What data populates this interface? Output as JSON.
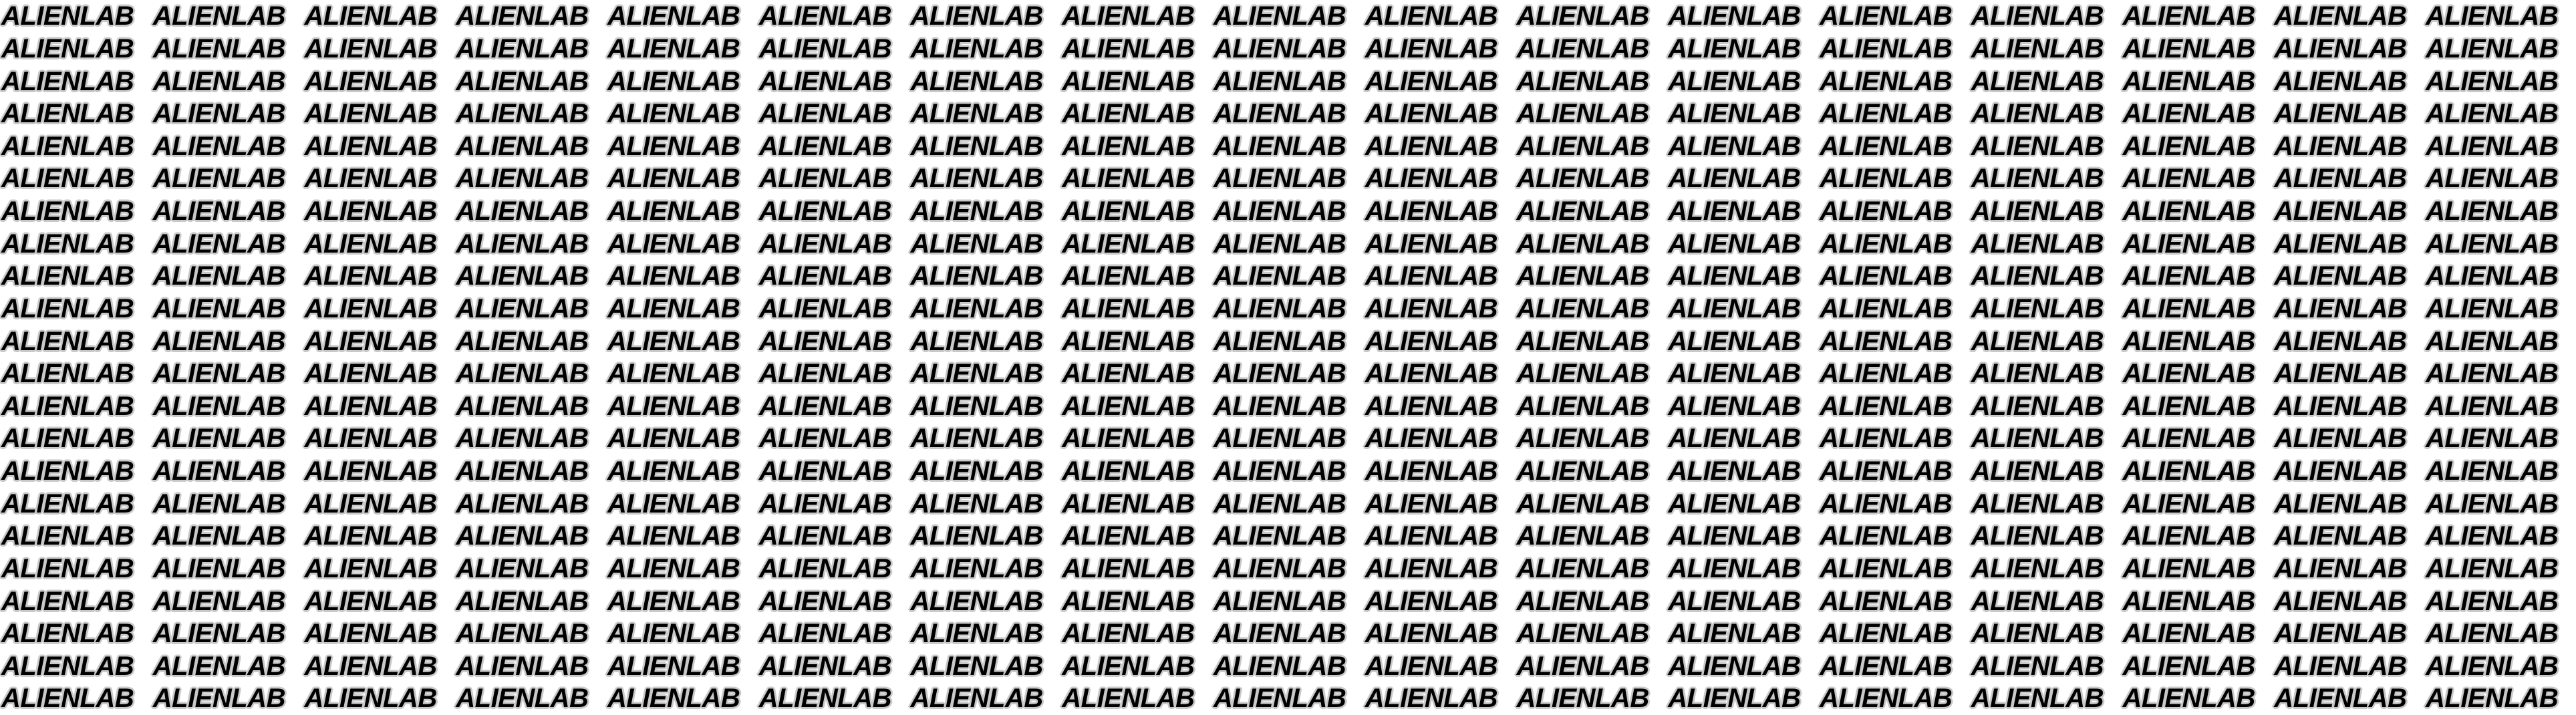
{
  "background_color": "#ffffff",
  "text_color": "#000000",
  "outline_color": "#c9c9c9",
  "pattern": {
    "text": "ALIENLAB",
    "columns": 17,
    "rows": 22
  }
}
